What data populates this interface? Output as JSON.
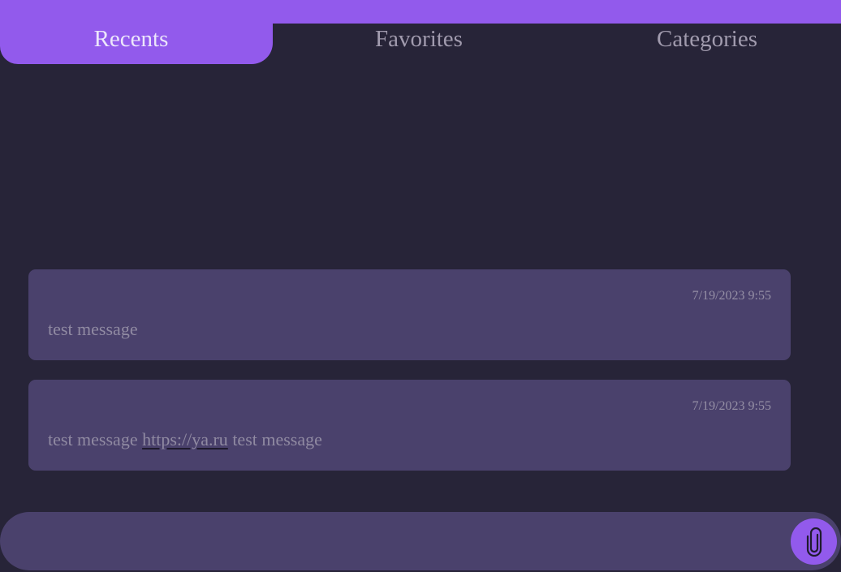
{
  "tabs": [
    {
      "label": "Recents",
      "active": true
    },
    {
      "label": "Favorites",
      "active": false
    },
    {
      "label": "Categories",
      "active": false
    }
  ],
  "messages": [
    {
      "timestamp": "7/19/2023 9:55",
      "parts": {
        "text": "test message"
      }
    },
    {
      "timestamp": "7/19/2023 9:55",
      "parts": {
        "before": "test message ",
        "link": "https://ya.ru",
        "after": " test message"
      }
    }
  ],
  "composer": {
    "value": "",
    "placeholder": "",
    "attach_icon": "paperclip-icon"
  },
  "colors": {
    "accent": "#925aec",
    "background": "#272438",
    "card": "#4a416c"
  }
}
